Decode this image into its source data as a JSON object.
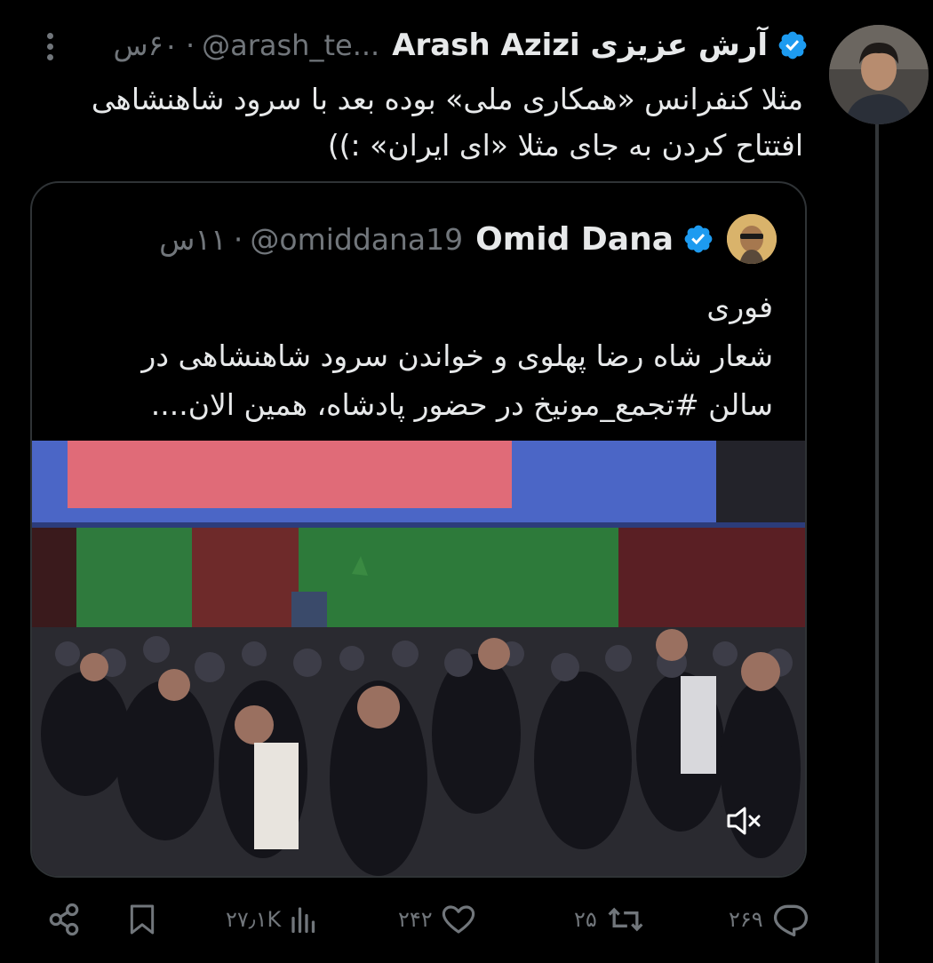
{
  "tweet": {
    "author_name": "آرش عزیزی Arash Azizi",
    "handle": "@arash_te...",
    "time": "۶۰س",
    "text": "مثلا کنفرانس «همکاری ملی» بوده بعد با سرود شاهنشاهی\nافتتاح کردن به جای مثلا «ای ایران» :))"
  },
  "quote": {
    "author_name": "Omid Dana",
    "handle": "@omiddana19",
    "time": "۱۱س",
    "text": "فوری\nشعار شاه رضا پهلوی و خواندن سرود شاهنشاهی در\nسالن #تجمع_مونیخ در حضور پادشاه، همین الان...."
  },
  "actions": {
    "replies": "۲۶۹",
    "retweets": "۲۵",
    "likes": "۲۴۲",
    "views": "۲۷٫۱K"
  },
  "colors": {
    "background": "#000000",
    "text": "#e7e9ea",
    "muted": "#71767b",
    "verified": "#1d9bf0",
    "border": "#2f3336"
  }
}
